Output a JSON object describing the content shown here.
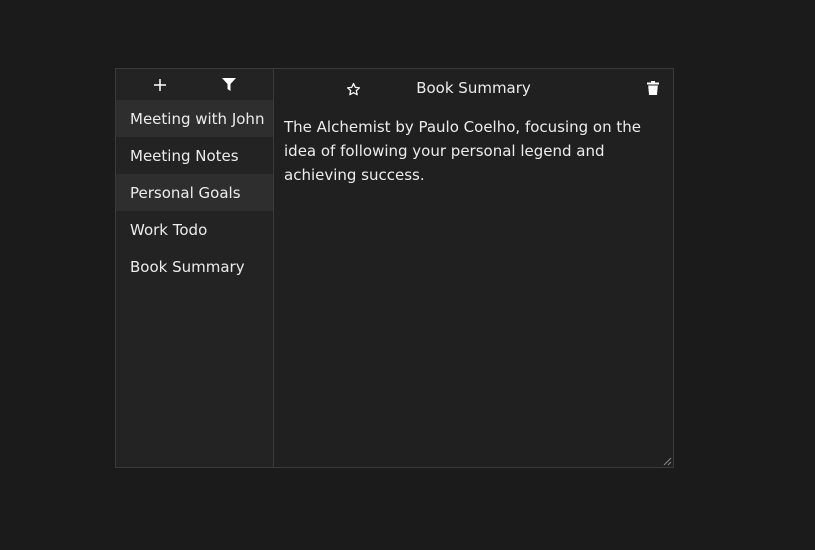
{
  "sidebar": {
    "toolbar": {
      "add_icon": "plus-icon",
      "filter_icon": "filter-icon"
    },
    "notes": [
      {
        "title": "Meeting with John"
      },
      {
        "title": "Meeting Notes"
      },
      {
        "title": "Personal Goals"
      },
      {
        "title": "Work Todo"
      },
      {
        "title": "Book Summary"
      }
    ]
  },
  "editor": {
    "title": "Book Summary",
    "body": "The Alchemist by Paulo Coelho, focusing on the idea of following your personal legend and achieving success.",
    "star_icon": "star-outline-icon",
    "delete_icon": "trash-icon"
  },
  "colors": {
    "page_background": "#1b1b1b",
    "panel_background": "#202020",
    "sidebar_background": "#232323",
    "shaded_row": "#2e2e2e",
    "border": "#3a3a3a",
    "text": "#ececec"
  }
}
